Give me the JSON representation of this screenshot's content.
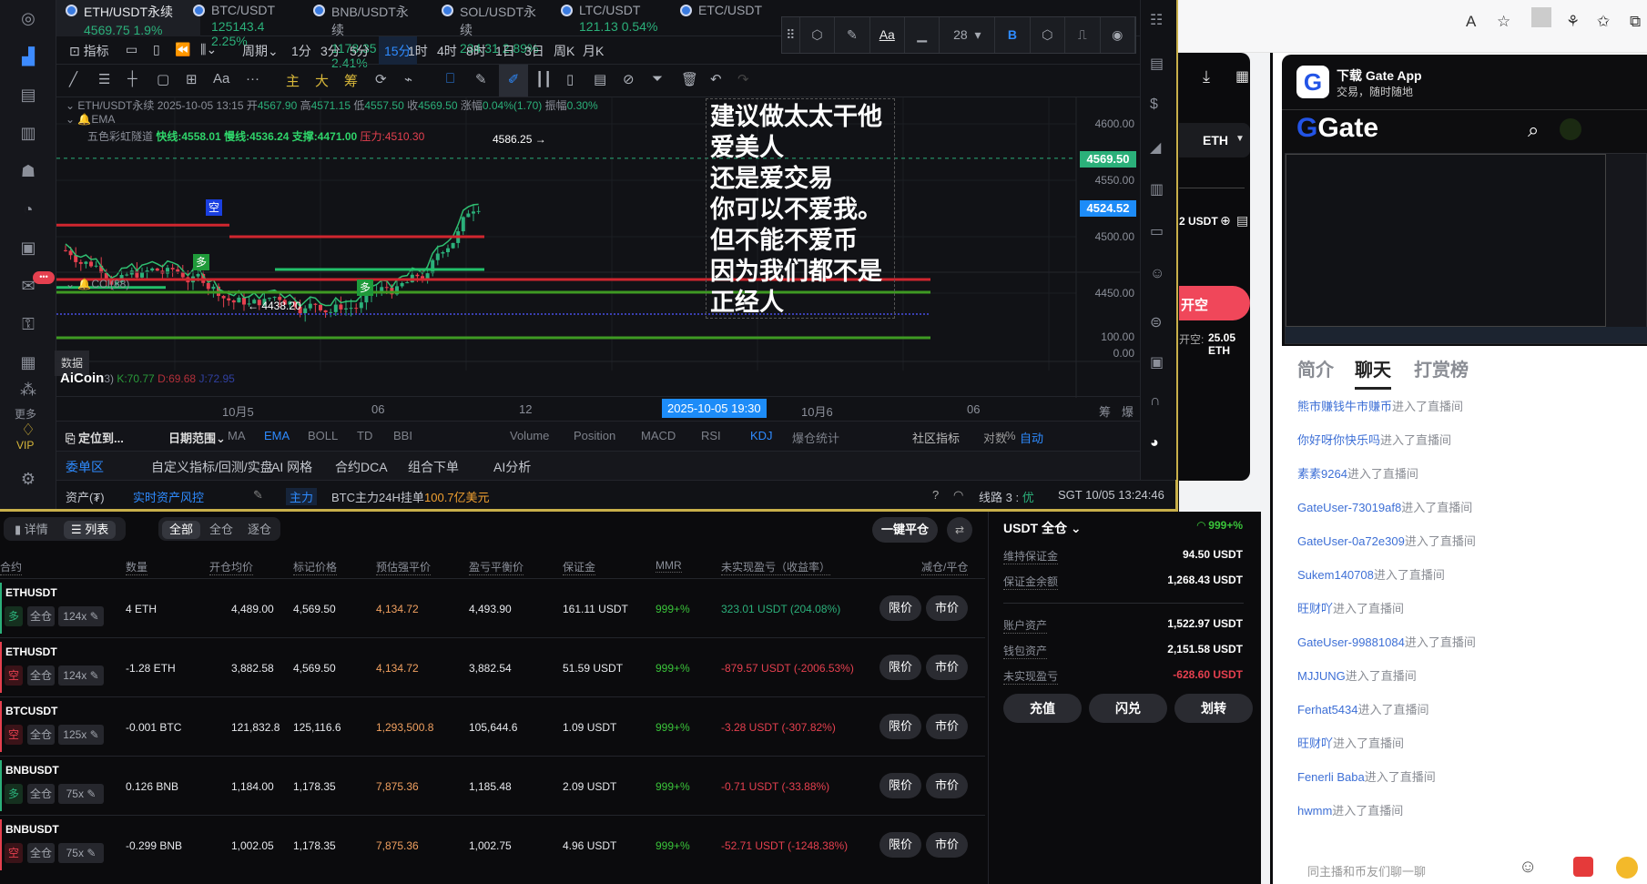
{
  "tabs": [
    {
      "pair": "ETH/USDT永续",
      "price": "4569.75",
      "change": "1.9%"
    },
    {
      "pair": "BTC/USDT",
      "price": "125143.4",
      "change": "2.25%"
    },
    {
      "pair": "BNB/USDT永续",
      "price": "1178.35",
      "change": "2.41%"
    },
    {
      "pair": "SOL/USDT永续",
      "price": "234.31",
      "change": "2.89%"
    },
    {
      "pair": "LTC/USDT",
      "price": "121.13",
      "change": "0.54%"
    },
    {
      "pair": "ETC/USDT",
      "price": "",
      "change": ""
    }
  ],
  "periodbar": {
    "indicator": "指标",
    "period": "周期",
    "periods": [
      "1分",
      "3分",
      "5分",
      "15分",
      "1时",
      "4时",
      "8时",
      "1日",
      "3日",
      "周K",
      "月K"
    ],
    "active": "15分"
  },
  "drawbar": {
    "text_tool": "Aa",
    "more": "···",
    "main": "主",
    "big": "大",
    "chips": "筹"
  },
  "floatbar": {
    "aa": "Aa",
    "font_size": "28",
    "bold": "B"
  },
  "chart": {
    "info": {
      "pair": "ETH/USDT永续",
      "datetime": "2025-10-05 13:15",
      "open_label": "开",
      "open": "4567.90",
      "high_label": "高",
      "high": "4571.15",
      "low_label": "低",
      "low": "4557.50",
      "close_label": "收",
      "close": "4569.50",
      "chg_label": "涨幅",
      "chg": "0.04%(1.70)",
      "amp_label": "振幅",
      "amp": "0.30%"
    },
    "ema_label": "EMA",
    "rainbow": {
      "name": "五色彩虹隧道",
      "fast": "快线:4558.01",
      "slow": "慢线:4536.24",
      "support": "支撑:4471.00",
      "pressure_label": "压力:",
      "pressure": "4510.30"
    },
    "high_mark": "4586.25 →",
    "low_mark": "← 4438.20",
    "short_tag": "空",
    "long_tag": "多",
    "note_lines": [
      "建议做太太干他",
      "爱美人",
      "还是爱交易",
      "你可以不爱我。",
      "但不能不爱币",
      "因为我们都不是",
      "正经人"
    ],
    "price_labels": [
      "4600.00",
      "4550.00",
      "4500.00",
      "4450.00"
    ],
    "last_price": "4569.50",
    "line_price": "4524.52",
    "cci_label": "CCI(88)",
    "cci_labels": [
      "100.00",
      "0.00"
    ],
    "kdj": {
      "watermark": "AiCoin",
      "k": "K:70.77",
      "d": "D:69.68",
      "j": "J:72.95",
      "suffix": "3)"
    },
    "tooltip": "数据"
  },
  "timeaxis": {
    "labels": [
      "10月5",
      "06",
      "12",
      "10月6",
      "06"
    ],
    "cursor": "2025-10-05 19:30",
    "right1": "筹",
    "right2": "爆"
  },
  "inditabs": {
    "locate": "定位到...",
    "range": "日期范围",
    "main": [
      "MA",
      "EMA",
      "BOLL",
      "TD",
      "BBI"
    ],
    "sub": [
      "Volume",
      "Position",
      "MACD",
      "RSI",
      "KDJ",
      "爆仓统计"
    ],
    "community": "社区指标",
    "log": "对数",
    "pct": "%",
    "auto": "自动"
  },
  "btabs": [
    "委单区",
    "自定义指标/回测/实盘",
    "AI 网格",
    "合约DCA",
    "组合下单",
    "AI分析"
  ],
  "status": {
    "assets": "资产(₮)",
    "risk": "实时资产风控",
    "main": "主力",
    "ticker": "BTC主力24H挂单",
    "amount": "100.7亿美元",
    "line": "线路 3 : ",
    "quality": "优",
    "time": "SGT  10/05 13:24:46"
  },
  "sidebar": {
    "more": "更多",
    "vip": "VIP"
  },
  "positions": {
    "view": [
      "详情",
      "列表"
    ],
    "filter": [
      "全部",
      "全仓",
      "逐仓"
    ],
    "close_all": "一键平仓",
    "headers": [
      "合约",
      "数量",
      "开仓均价",
      "标记价格",
      "预估强平价",
      "盈亏平衡价",
      "保证金",
      "MMR",
      "未实现盈亏（收益率）",
      "减仓/平仓"
    ],
    "limit": "限价",
    "market": "市价",
    "mode": "全仓",
    "rows": [
      {
        "symbol": "ETHUSDT",
        "side": "多",
        "lev": "124x",
        "qty": "4 ETH",
        "entry": "4,489.00",
        "mark": "4,569.50",
        "liq": "4,134.72",
        "be": "4,493.90",
        "margin": "161.11 USDT",
        "mmr": "999+%",
        "pnl": "323.01 USDT (204.08%)"
      },
      {
        "symbol": "ETHUSDT",
        "side": "空",
        "lev": "124x",
        "qty": "-1.28 ETH",
        "entry": "3,882.58",
        "mark": "4,569.50",
        "liq": "4,134.72",
        "be": "3,882.54",
        "margin": "51.59 USDT",
        "mmr": "999+%",
        "pnl": "-879.57 USDT (-2006.53%)"
      },
      {
        "symbol": "BTCUSDT",
        "side": "空",
        "lev": "125x",
        "qty": "-0.001 BTC",
        "entry": "121,832.8",
        "mark": "125,116.6",
        "liq": "1,293,500.8",
        "be": "105,644.6",
        "margin": "1.09 USDT",
        "mmr": "999+%",
        "pnl": "-3.28 USDT (-307.82%)"
      },
      {
        "symbol": "BNBUSDT",
        "side": "多",
        "lev": "75x",
        "qty": "0.126 BNB",
        "entry": "1,184.00",
        "mark": "1,178.35",
        "liq": "7,875.36",
        "be": "1,185.48",
        "margin": "2.09 USDT",
        "mmr": "999+%",
        "pnl": "-0.71 USDT (-33.88%)"
      },
      {
        "symbol": "BNBUSDT",
        "side": "空",
        "lev": "75x",
        "qty": "-0.299 BNB",
        "entry": "1,002.05",
        "mark": "1,178.35",
        "liq": "7,875.36",
        "be": "1,002.75",
        "margin": "4.96 USDT",
        "mmr": "999+%",
        "pnl": "-52.71 USDT (-1248.38%)"
      }
    ]
  },
  "account": {
    "title": "USDT 全仓",
    "ratio": "999+%",
    "items": [
      {
        "label": "维持保证金",
        "value": "94.50 USDT"
      },
      {
        "label": "保证金余额",
        "value": "1,268.43 USDT"
      },
      {
        "label": "账户资产",
        "value": "1,522.97 USDT"
      },
      {
        "label": "钱包资产",
        "value": "2,151.58 USDT"
      },
      {
        "label": "未实现盈亏",
        "value": "-628.60 USDT"
      }
    ],
    "buttons": [
      "充值",
      "闪兑",
      "划转"
    ]
  },
  "gate_panel": {
    "coin": "ETH",
    "balance": "2 USDT",
    "open_short": "开空",
    "open_short_info_label": "开空:",
    "open_short_info": "25.05 ETH"
  },
  "app_card": {
    "title": "下载 Gate App",
    "subtitle": "交易，随时随地",
    "brand": "Gate"
  },
  "chat_tabs": [
    "简介",
    "聊天",
    "打赏榜"
  ],
  "chat": [
    {
      "user": "熊市赚钱牛市赚币",
      "msg": "进入了直播间"
    },
    {
      "user": "你好呀你快乐吗",
      "msg": "进入了直播间"
    },
    {
      "user": "素素9264",
      "msg": "进入了直播间"
    },
    {
      "user": "GateUser-73019af8",
      "msg": "进入了直播间"
    },
    {
      "user": "GateUser-0a72e309",
      "msg": "进入了直播间"
    },
    {
      "user": "Sukem140708",
      "msg": "进入了直播间"
    },
    {
      "user": "旺财吖",
      "msg": "进入了直播间"
    },
    {
      "user": "GateUser-99881084",
      "msg": "进入了直播间"
    },
    {
      "user": "MJJUNG",
      "msg": "进入了直播间"
    },
    {
      "user": "Ferhat5434",
      "msg": "进入了直播间"
    },
    {
      "user": "旺财吖",
      "msg": "进入了直播间"
    },
    {
      "user": "Fenerli Baba",
      "msg": "进入了直播间"
    },
    {
      "user": "hwmm",
      "msg": "进入了直播间"
    }
  ],
  "chat_input": {
    "placeholder": "同主播和币友们聊一聊"
  },
  "colors": {
    "up": "#2bb07a",
    "down": "#e5404f",
    "accent": "#2e8bff",
    "gold": "#c9b04a"
  }
}
